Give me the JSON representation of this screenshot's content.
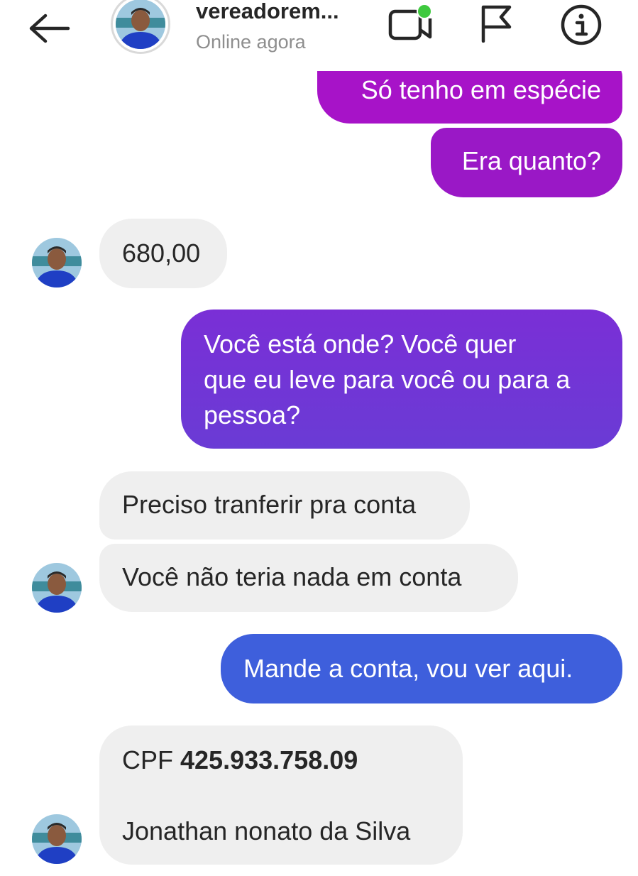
{
  "header": {
    "back_icon": "arrow-left-icon",
    "username": "vereadorem...",
    "status": "Online agora",
    "video_icon": "video-call-icon",
    "flag_icon": "flag-icon",
    "info_icon": "info-icon",
    "online_dot_color": "#3ec93e"
  },
  "messages": [
    {
      "side": "sent",
      "text": "Só tenho em espécie"
    },
    {
      "side": "sent",
      "text": "Era quanto?"
    },
    {
      "side": "received",
      "text": "680,00"
    },
    {
      "side": "sent",
      "text_lines": [
        "Você está onde? Você quer",
        "que eu leve para você ou para a",
        "pessoa?"
      ]
    },
    {
      "side": "received",
      "text": "Preciso tranferir pra conta"
    },
    {
      "side": "received",
      "text": "Você não teria nada em conta"
    },
    {
      "side": "sent",
      "text": "Mande a conta, vou ver aqui."
    },
    {
      "side": "received",
      "cpf_label": "CPF",
      "cpf_number": "425.933.758.09",
      "name_line": "Jonathan nonato da Silva"
    }
  ],
  "colors": {
    "sent_purple": "#a713c8",
    "sent_violet": "#6a3bd5",
    "sent_blue": "#3e5fdc",
    "received_bg": "#efefef"
  }
}
